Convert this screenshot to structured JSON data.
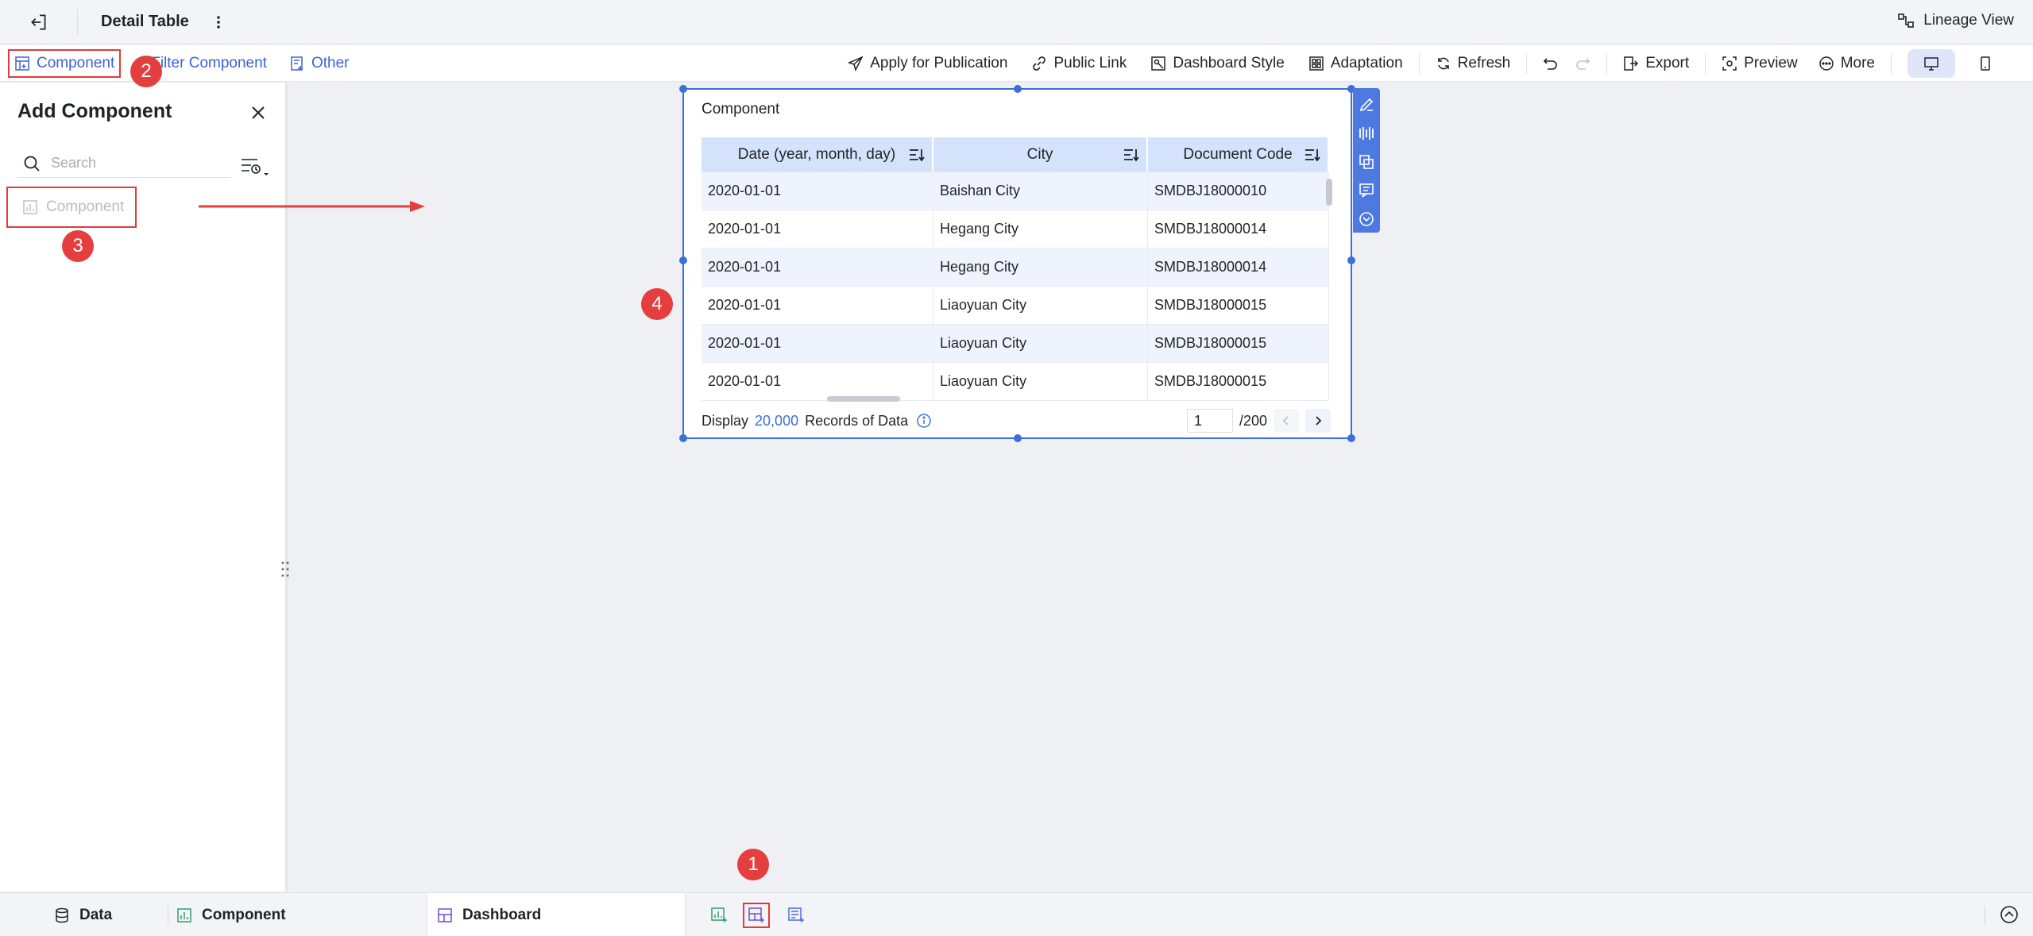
{
  "topbar": {
    "title": "Detail Table",
    "lineage_label": "Lineage View"
  },
  "toolbar": {
    "component_label": "Component",
    "filter_component_label": "Filter Component",
    "other_label": "Other",
    "apply_publication_label": "Apply for Publication",
    "public_link_label": "Public Link",
    "dashboard_style_label": "Dashboard Style",
    "adaptation_label": "Adaptation",
    "refresh_label": "Refresh",
    "export_label": "Export",
    "preview_label": "Preview",
    "more_label": "More"
  },
  "panel": {
    "heading": "Add Component",
    "search_placeholder": "Search",
    "component_item_label": "Component"
  },
  "annotations": [
    "1",
    "2",
    "3",
    "4"
  ],
  "widget": {
    "title": "Component",
    "columns": [
      "Date (year, month, day)",
      "City",
      "Document Code"
    ],
    "rows": [
      [
        "2020-01-01",
        "Baishan City",
        "SMDBJ18000010"
      ],
      [
        "2020-01-01",
        "Hegang City",
        "SMDBJ18000014"
      ],
      [
        "2020-01-01",
        "Hegang City",
        "SMDBJ18000014"
      ],
      [
        "2020-01-01",
        "Liaoyuan City",
        "SMDBJ18000015"
      ],
      [
        "2020-01-01",
        "Liaoyuan City",
        "SMDBJ18000015"
      ],
      [
        "2020-01-01",
        "Liaoyuan City",
        "SMDBJ18000015"
      ]
    ],
    "footer": {
      "display_label": "Display",
      "record_count": "20,000",
      "records_suffix": "Records of Data",
      "current_page": "1",
      "total_pages": "/200"
    }
  },
  "bottombar": {
    "data_label": "Data",
    "component_label": "Component",
    "dashboard_label": "Dashboard"
  },
  "colors": {
    "accent": "#3d6fd9",
    "annotation_red": "#e53e3e",
    "header_bg": "#d4e3fb",
    "stripe_bg": "#eef3fd"
  },
  "icons": [
    "exit-icon",
    "vertical-dots-icon",
    "lineage-icon",
    "component-icon",
    "filter-component-icon",
    "other-icon",
    "send-icon",
    "link-icon",
    "dashboard-style-icon",
    "adaptation-icon",
    "refresh-icon",
    "undo-icon",
    "redo-icon",
    "export-icon",
    "preview-icon",
    "more-icon",
    "desktop-icon",
    "mobile-icon",
    "close-icon",
    "search-icon",
    "filter-settings-icon",
    "sort-icon",
    "info-icon",
    "edit-icon",
    "chart-type-icon",
    "copy-icon",
    "comment-icon",
    "collapse-icon",
    "database-icon",
    "dashboard-icon"
  ]
}
